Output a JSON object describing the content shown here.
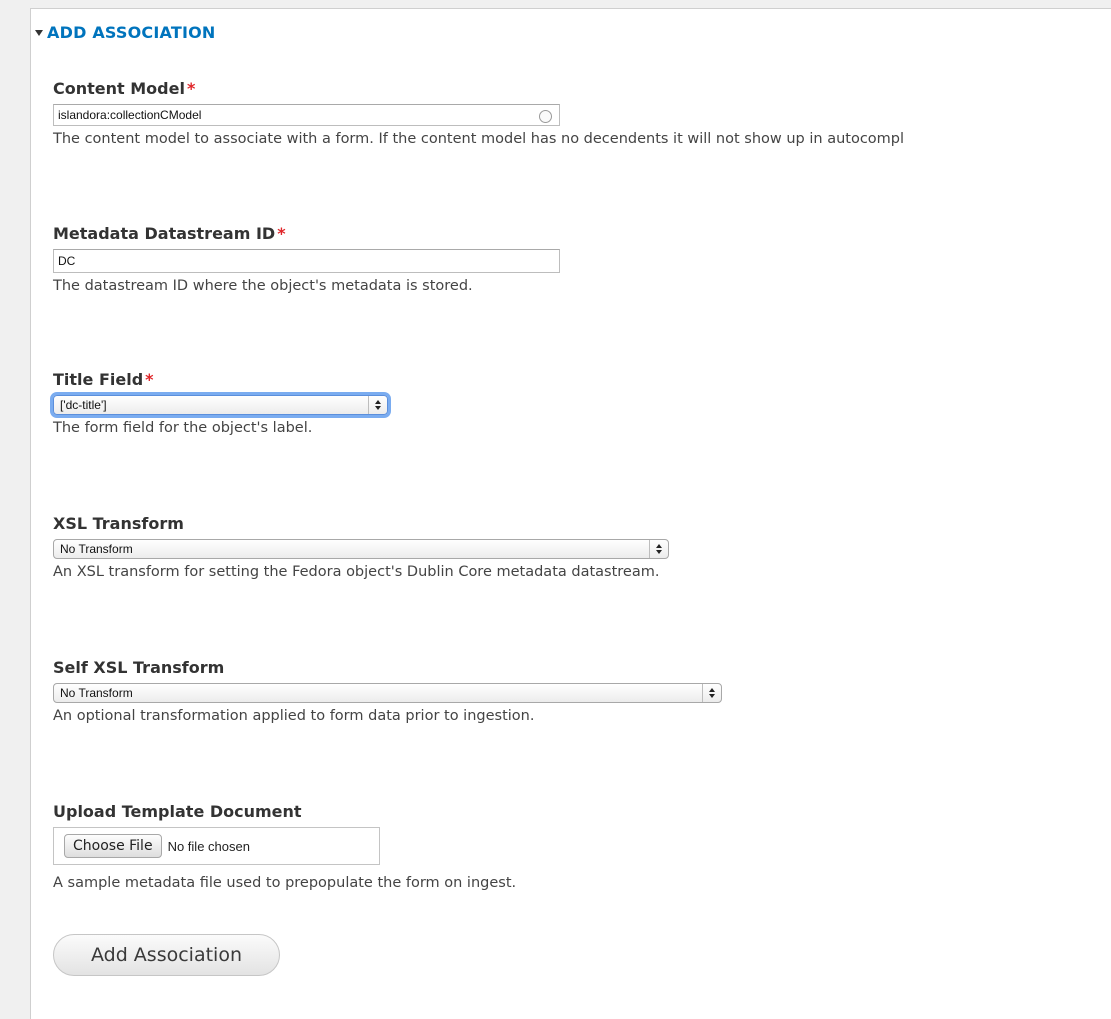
{
  "legend": "ADD ASSOCIATION",
  "required_marker": "*",
  "fields": {
    "content_model": {
      "label": "Content Model",
      "value": "islandora:collectionCModel",
      "description": "The content model to associate with a form. If the content model has no decendents it will not show up in autocompl"
    },
    "metadata_dsid": {
      "label": "Metadata Datastream ID",
      "value": "DC",
      "description": "The datastream ID where the object's metadata is stored."
    },
    "title_field": {
      "label": "Title Field",
      "value": "['dc-title']",
      "description": "The form field for the object's label."
    },
    "xsl_transform": {
      "label": "XSL Transform",
      "value": "No Transform",
      "description": "An XSL transform for setting the Fedora object's Dublin Core metadata datastream."
    },
    "self_xsl_transform": {
      "label": "Self XSL Transform",
      "value": "No Transform",
      "description": "An optional transformation applied to form data prior to ingestion."
    },
    "upload_template": {
      "label": "Upload Template Document",
      "choose_label": "Choose File",
      "file_status": "No file chosen",
      "description": "A sample metadata file used to prepopulate the form on ingest."
    }
  },
  "submit_label": "Add Association",
  "colors": {
    "legend": "#0074bd",
    "required": "#e0262a",
    "focus_ring": "#7aacf0"
  }
}
